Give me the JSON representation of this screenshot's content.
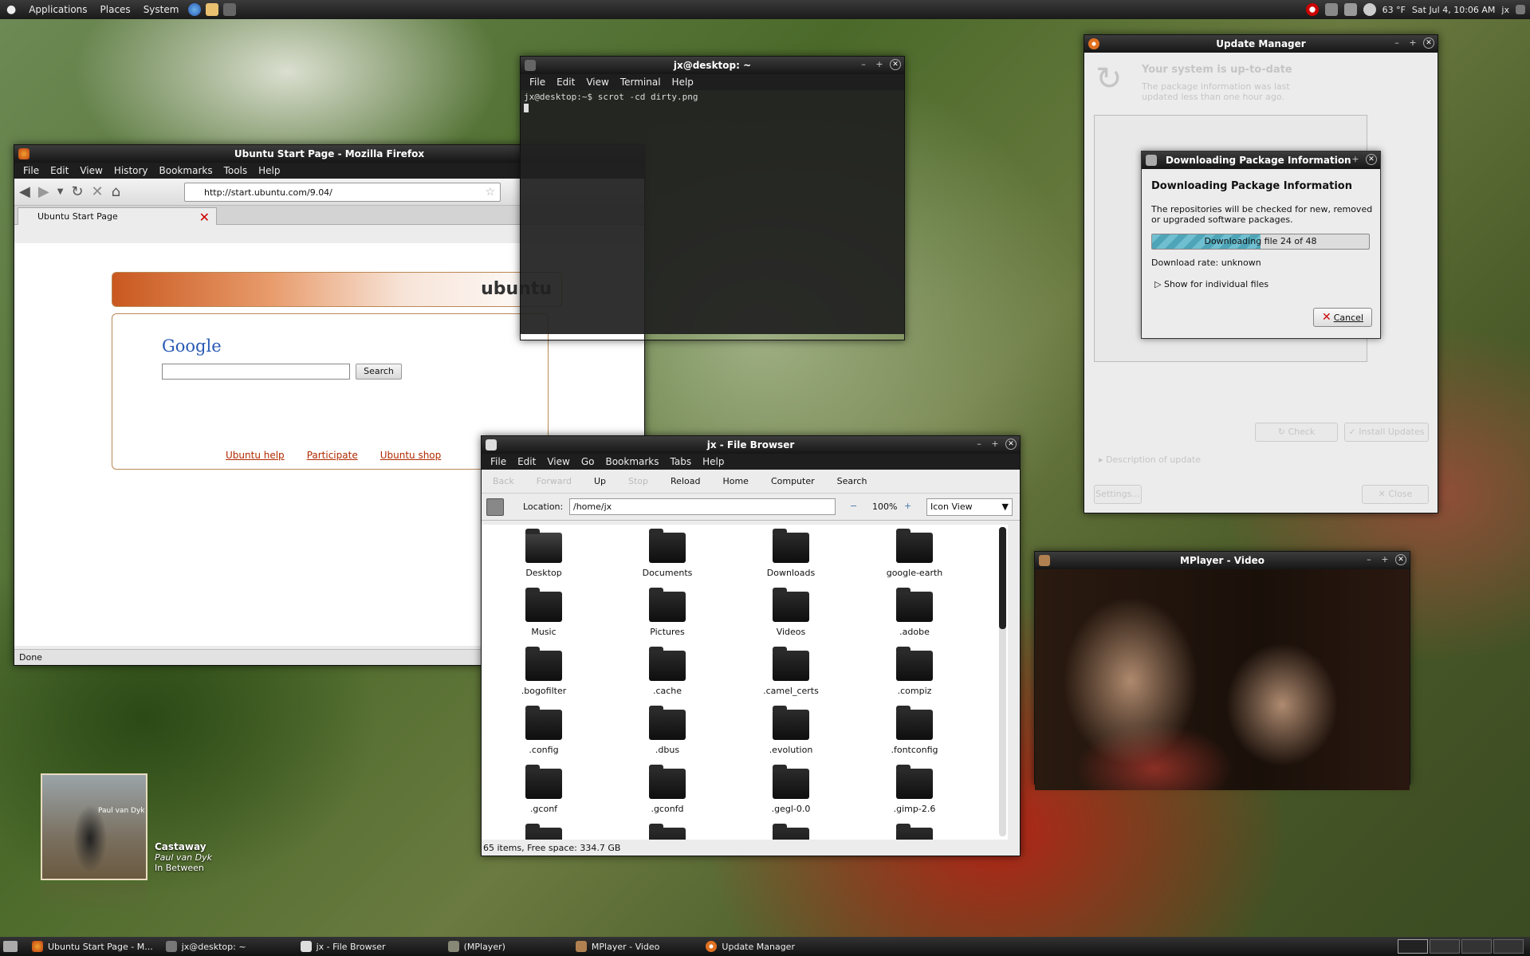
{
  "top_panel": {
    "menus": [
      "Applications",
      "Places",
      "System"
    ],
    "temperature": "63 °F",
    "clock": "Sat Jul  4, 10:06 AM",
    "user": "jx"
  },
  "firefox": {
    "title": "Ubuntu Start Page - Mozilla Firefox",
    "menus": [
      "File",
      "Edit",
      "View",
      "History",
      "Bookmarks",
      "Tools",
      "Help"
    ],
    "url": "http://start.ubuntu.com/9.04/",
    "tab_label": "Ubuntu Start Page",
    "ubuntu_logo_text": "ubuntu",
    "google_logo": "Google",
    "search_button": "Search",
    "links": [
      "Ubuntu help",
      "Participate",
      "Ubuntu shop"
    ],
    "status": "Done"
  },
  "terminal": {
    "title": "jx@desktop: ~",
    "menus": [
      "File",
      "Edit",
      "View",
      "Terminal",
      "Help"
    ],
    "line": "jx@desktop:~$ scrot -cd dirty.png"
  },
  "update_manager": {
    "title": "Update Manager",
    "heading": "Your system is up-to-date",
    "subtext": "The package information was last updated less than one hour ago.",
    "check_button": "Check",
    "install_button": "Install Updates",
    "description": "Description of update",
    "settings_button": "Settings...",
    "close_button": "Close"
  },
  "download_dialog": {
    "title": "Downloading Package Information",
    "heading": "Downloading Package Information",
    "body": "The repositories will be checked for new, removed or upgraded software packages.",
    "progress_text": "Downloading file 24 of 48",
    "progress_fraction": 0.5,
    "rate": "Download rate: unknown",
    "expander": "Show for individual files",
    "cancel_button": "Cancel"
  },
  "file_browser": {
    "title": "jx - File Browser",
    "menus": [
      "File",
      "Edit",
      "View",
      "Go",
      "Bookmarks",
      "Tabs",
      "Help"
    ],
    "toolbar": {
      "back": "Back",
      "forward": "Forward",
      "up": "Up",
      "stop": "Stop",
      "reload": "Reload",
      "home": "Home",
      "computer": "Computer",
      "search": "Search"
    },
    "location_label": "Location:",
    "location_value": "/home/jx",
    "zoom": "100%",
    "view_mode": "Icon View",
    "items": [
      "Desktop",
      "Documents",
      "Downloads",
      "google-earth",
      "Music",
      "Pictures",
      "Videos",
      ".adobe",
      ".bogofilter",
      ".cache",
      ".camel_certs",
      ".compiz",
      ".config",
      ".dbus",
      ".evolution",
      ".fontconfig",
      ".gconf",
      ".gconfd",
      ".gegl-0.0",
      ".gimp-2.6"
    ],
    "status": "65 items, Free space: 334.7 GB"
  },
  "mplayer": {
    "title": "MPlayer - Video"
  },
  "music_widget": {
    "album_text": "Paul van Dyk",
    "song": "Castaway",
    "artist": "Paul van Dyk",
    "album": "In Between"
  },
  "taskbar": {
    "tasks": [
      "Ubuntu Start Page - M...",
      "jx@desktop: ~",
      "jx - File Browser",
      "(MPlayer)",
      "MPlayer - Video",
      "Update Manager"
    ]
  },
  "colors": {
    "panel": "#1a1a1a",
    "progress": "#4fa5b8",
    "link": "#b02a00"
  }
}
